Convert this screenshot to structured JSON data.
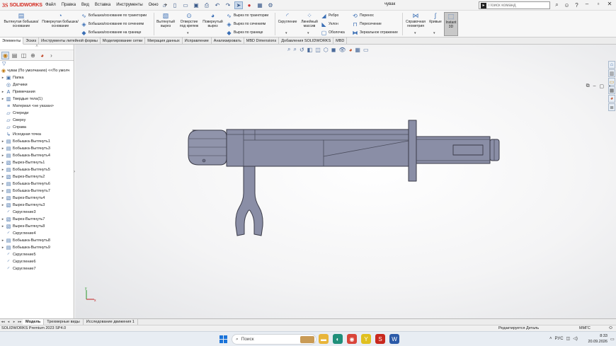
{
  "app": {
    "logo_ds": "3S",
    "logo_text": "SOLIDWORKS",
    "document_title": "чувак",
    "search_placeholder": "Поиск команд"
  },
  "menus": [
    "Файл",
    "Правка",
    "Вид",
    "Вставка",
    "Инструменты",
    "Окно"
  ],
  "ribbon": {
    "extrude_boss": "Вытянутая бобышка/основание",
    "revolve_boss": "Повернутая бобышка/основание",
    "swept_boss": "Бобышка/основание по траектории",
    "lofted_boss": "Бобышка/основание по сечениям",
    "boundary_boss": "Бобышка/основание на границе",
    "extruded_cut": "Вытянутый вырез",
    "hole_wizard": "Отверстие под крепеж",
    "revolved_cut": "Повернутый вырез",
    "swept_cut": "Вырез по траектории",
    "lofted_cut": "Вырез по сечениям",
    "boundary_cut": "Вырез по границе",
    "fillet": "Скругление",
    "linear_pattern": "Линейный массив",
    "rib": "Ребро",
    "draft": "Уклон",
    "shell": "Оболочка",
    "wrap": "Перенос",
    "intersect": "Пересечение",
    "mirror": "Зеркальное отражение",
    "ref_geometry": "Справочная геометрия",
    "curves": "Кривые",
    "instant3d": "Instant 3D"
  },
  "command_tabs": [
    "Элементы",
    "Эскиз",
    "Инструменты литейной формы",
    "Моделирование сетки",
    "Миграция данных",
    "Исправление",
    "Анализировать",
    "MBD Dimensions",
    "Добавления SOLIDWORKS",
    "MBD"
  ],
  "tree": {
    "root": "чувак (По умолчанию) <<По умолч",
    "items": [
      {
        "label": "Папка",
        "expander": "▸",
        "icon": "folder-icon",
        "glyph": "▣"
      },
      {
        "label": "Датчики",
        "expander": "",
        "icon": "sensor-icon",
        "glyph": "◎"
      },
      {
        "label": "Примечания",
        "expander": "▸",
        "icon": "annotation-icon",
        "glyph": "A"
      },
      {
        "label": "Твердые тела(1)",
        "expander": "▸",
        "icon": "solid-bodies-icon",
        "glyph": "▥"
      },
      {
        "label": "Материал <не указан>",
        "expander": "",
        "icon": "material-icon",
        "glyph": "≡"
      },
      {
        "label": "Спереди",
        "expander": "",
        "icon": "plane-icon",
        "glyph": "▱"
      },
      {
        "label": "Сверху",
        "expander": "",
        "icon": "plane-icon",
        "glyph": "▱"
      },
      {
        "label": "Справа",
        "expander": "",
        "icon": "plane-icon",
        "glyph": "▱"
      },
      {
        "label": "Исходная точка",
        "expander": "",
        "icon": "origin-icon",
        "glyph": "↳"
      },
      {
        "label": "Бобышка-Вытянуть1",
        "expander": "▸",
        "icon": "extrude-icon",
        "glyph": "▤"
      },
      {
        "label": "Бобышка-Вытянуть3",
        "expander": "▸",
        "icon": "extrude-icon",
        "glyph": "▤"
      },
      {
        "label": "Бобышка-Вытянуть4",
        "expander": "▸",
        "icon": "extrude-icon",
        "glyph": "▤"
      },
      {
        "label": "Вырез-Вытянуть1",
        "expander": "▸",
        "icon": "cut-icon",
        "glyph": "▧"
      },
      {
        "label": "Бобышка-Вытянуть5",
        "expander": "▸",
        "icon": "extrude-icon",
        "glyph": "▤"
      },
      {
        "label": "Вырез-Вытянуть2",
        "expander": "▸",
        "icon": "cut-icon",
        "glyph": "▧"
      },
      {
        "label": "Бобышка-Вытянуть6",
        "expander": "▸",
        "icon": "extrude-icon",
        "glyph": "▤"
      },
      {
        "label": "Бобышка-Вытянуть7",
        "expander": "▸",
        "icon": "extrude-icon",
        "glyph": "▤"
      },
      {
        "label": "Вырез-Вытянуть4",
        "expander": "▸",
        "icon": "cut-icon",
        "glyph": "▧"
      },
      {
        "label": "Вырез-Вытянуть3",
        "expander": "▸",
        "icon": "cut-icon",
        "glyph": "▧"
      },
      {
        "label": "Скругление3",
        "expander": "",
        "icon": "fillet-icon",
        "glyph": "◜"
      },
      {
        "label": "Вырез-Вытянуть7",
        "expander": "▸",
        "icon": "cut-icon",
        "glyph": "▧"
      },
      {
        "label": "Вырез-Вытянуть8",
        "expander": "▸",
        "icon": "cut-icon",
        "glyph": "▧"
      },
      {
        "label": "Скругление4",
        "expander": "",
        "icon": "fillet-icon",
        "glyph": "◜"
      },
      {
        "label": "Бобышка-Вытянуть8",
        "expander": "▸",
        "icon": "extrude-icon",
        "glyph": "▤"
      },
      {
        "label": "Бобышка-Вытянуть9",
        "expander": "▸",
        "icon": "extrude-icon",
        "glyph": "▤"
      },
      {
        "label": "Скругление5",
        "expander": "",
        "icon": "fillet-icon",
        "glyph": "◜"
      },
      {
        "label": "Скругление6",
        "expander": "",
        "icon": "fillet-icon",
        "glyph": "◜"
      },
      {
        "label": "Скругление7",
        "expander": "",
        "icon": "fillet-icon",
        "glyph": "◜"
      }
    ]
  },
  "bottom_tabs": [
    "Модель",
    "Трехмерные виды",
    "Исследование движения 1"
  ],
  "status": {
    "version": "SOLIDWORKS Premium 2023 SP4.0",
    "editing": "Редактируется Деталь",
    "units": "ММГС"
  },
  "taskbar": {
    "search": "Поиск",
    "lang": "РУС",
    "time": "8:33",
    "date": "20.09.2026"
  },
  "colors": {
    "part_face": "#8a8ea6",
    "part_edge": "#3a3b48",
    "accent": "#d42a20"
  }
}
